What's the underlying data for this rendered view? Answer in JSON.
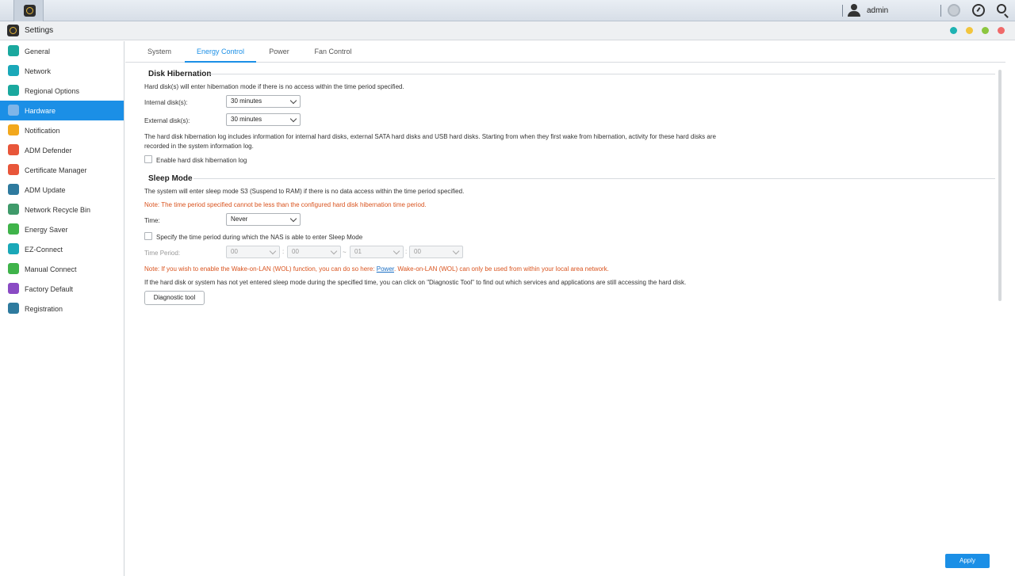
{
  "topbar": {
    "user": "admin"
  },
  "window": {
    "title": "Settings"
  },
  "colors": {
    "accent": "#1b8fe6",
    "note": "#d9531e",
    "dot1": "#1fb3b3",
    "dot2": "#f2c53d",
    "dot3": "#8cc63f",
    "dot4": "#f06a6a"
  },
  "sidebar": {
    "items": [
      {
        "label": "General",
        "icon": "general-icon",
        "color": "#1aa89e"
      },
      {
        "label": "Network",
        "icon": "globe-icon",
        "color": "#1aa8b8"
      },
      {
        "label": "Regional Options",
        "icon": "regional-icon",
        "color": "#1aa89e"
      },
      {
        "label": "Hardware",
        "icon": "hardware-icon",
        "color": "#7fb5e8"
      },
      {
        "label": "Notification",
        "icon": "notification-icon",
        "color": "#f2a81d"
      },
      {
        "label": "ADM Defender",
        "icon": "defender-icon",
        "color": "#e8563a"
      },
      {
        "label": "Certificate Manager",
        "icon": "certificate-icon",
        "color": "#e8563a"
      },
      {
        "label": "ADM Update",
        "icon": "update-icon",
        "color": "#2e7a9e"
      },
      {
        "label": "Network Recycle Bin",
        "icon": "recycle-bin-icon",
        "color": "#3f9a6a"
      },
      {
        "label": "Energy Saver",
        "icon": "energy-icon",
        "color": "#3fb34a"
      },
      {
        "label": "EZ-Connect",
        "icon": "ez-connect-icon",
        "color": "#1aa8b8"
      },
      {
        "label": "Manual Connect",
        "icon": "manual-connect-icon",
        "color": "#3fb34a"
      },
      {
        "label": "Factory Default",
        "icon": "factory-default-icon",
        "color": "#8a4bc4"
      },
      {
        "label": "Registration",
        "icon": "registration-icon",
        "color": "#2e7a9e"
      }
    ]
  },
  "tabs": [
    "System",
    "Energy Control",
    "Power",
    "Fan Control"
  ],
  "hibernation": {
    "title": "Disk Hibernation",
    "desc": "Hard disk(s) will enter hibernation mode if there is no access within the time period specified.",
    "internal_label": "Internal disk(s):",
    "internal_value": "30 minutes",
    "external_label": "External disk(s):",
    "external_value": "30 minutes",
    "log_info_1": "The hard disk hibernation log includes information for internal hard disks, external SATA hard disks and USB hard disks. Starting from when they first wake from hibernation, activity for these hard disks are",
    "log_info_2": "recorded in the system information log.",
    "log_checkbox": "Enable hard disk hibernation log"
  },
  "sleep": {
    "title": "Sleep Mode",
    "desc": "The system will enter sleep mode S3 (Suspend to RAM) if there is no data access within the time period specified.",
    "note1": "Note: The time period specified cannot be less than the configured hard disk hibernation time period.",
    "time_label": "Time:",
    "time_value": "Never",
    "period_checkbox": "Specify the time period during which the NAS is able to enter Sleep Mode",
    "period_label": "Time Period:",
    "period_values": [
      "00",
      "00",
      "01",
      "00"
    ],
    "colon": ":",
    "dash": "~",
    "wol_note_pre": "Note: If you wish to enable the Wake-on-LAN (WOL) function, you can do so here: ",
    "wol_link": "Power",
    "wol_note_post": ". Wake-on-LAN (WOL) can only be used from within your local area network.",
    "diag_info": "If the hard disk or system has not yet entered sleep mode during the specified time, you can click on \"Diagnostic Tool\" to find out which services and applications are still accessing the hard disk.",
    "diag_button": "Diagnostic tool"
  },
  "apply_label": "Apply"
}
